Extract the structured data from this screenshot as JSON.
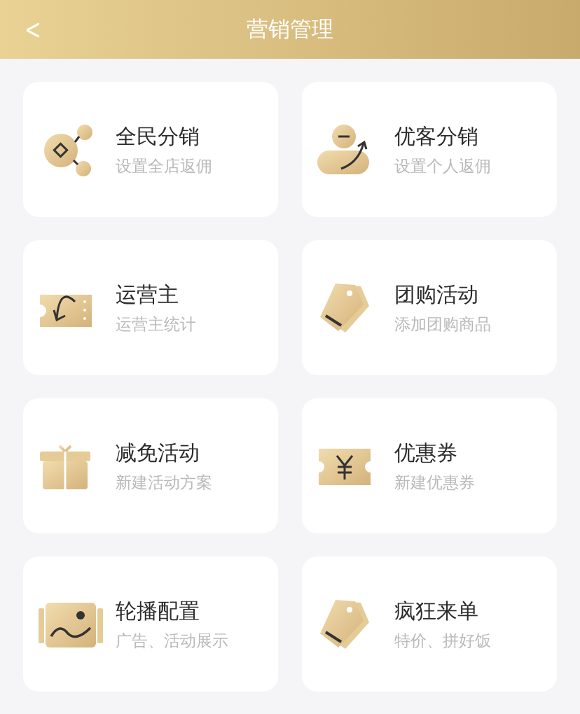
{
  "header": {
    "back": "<",
    "title": "营销管理"
  },
  "items": [
    {
      "kind": "share",
      "title": "全民分销",
      "subtitle": "设置全店返佣"
    },
    {
      "kind": "user-up",
      "title": "优客分销",
      "subtitle": "设置个人返佣"
    },
    {
      "kind": "ticket-back",
      "title": "运营主",
      "subtitle": "运营主统计"
    },
    {
      "kind": "tag",
      "title": "团购活动",
      "subtitle": "添加团购商品"
    },
    {
      "kind": "gift",
      "title": "减免活动",
      "subtitle": "新建活动方案"
    },
    {
      "kind": "coupon",
      "title": "优惠券",
      "subtitle": "新建优惠券"
    },
    {
      "kind": "image",
      "title": "轮播配置",
      "subtitle": "广告、活动展示"
    },
    {
      "kind": "tag",
      "title": "疯狂来单",
      "subtitle": "特价、拼好饭"
    }
  ]
}
